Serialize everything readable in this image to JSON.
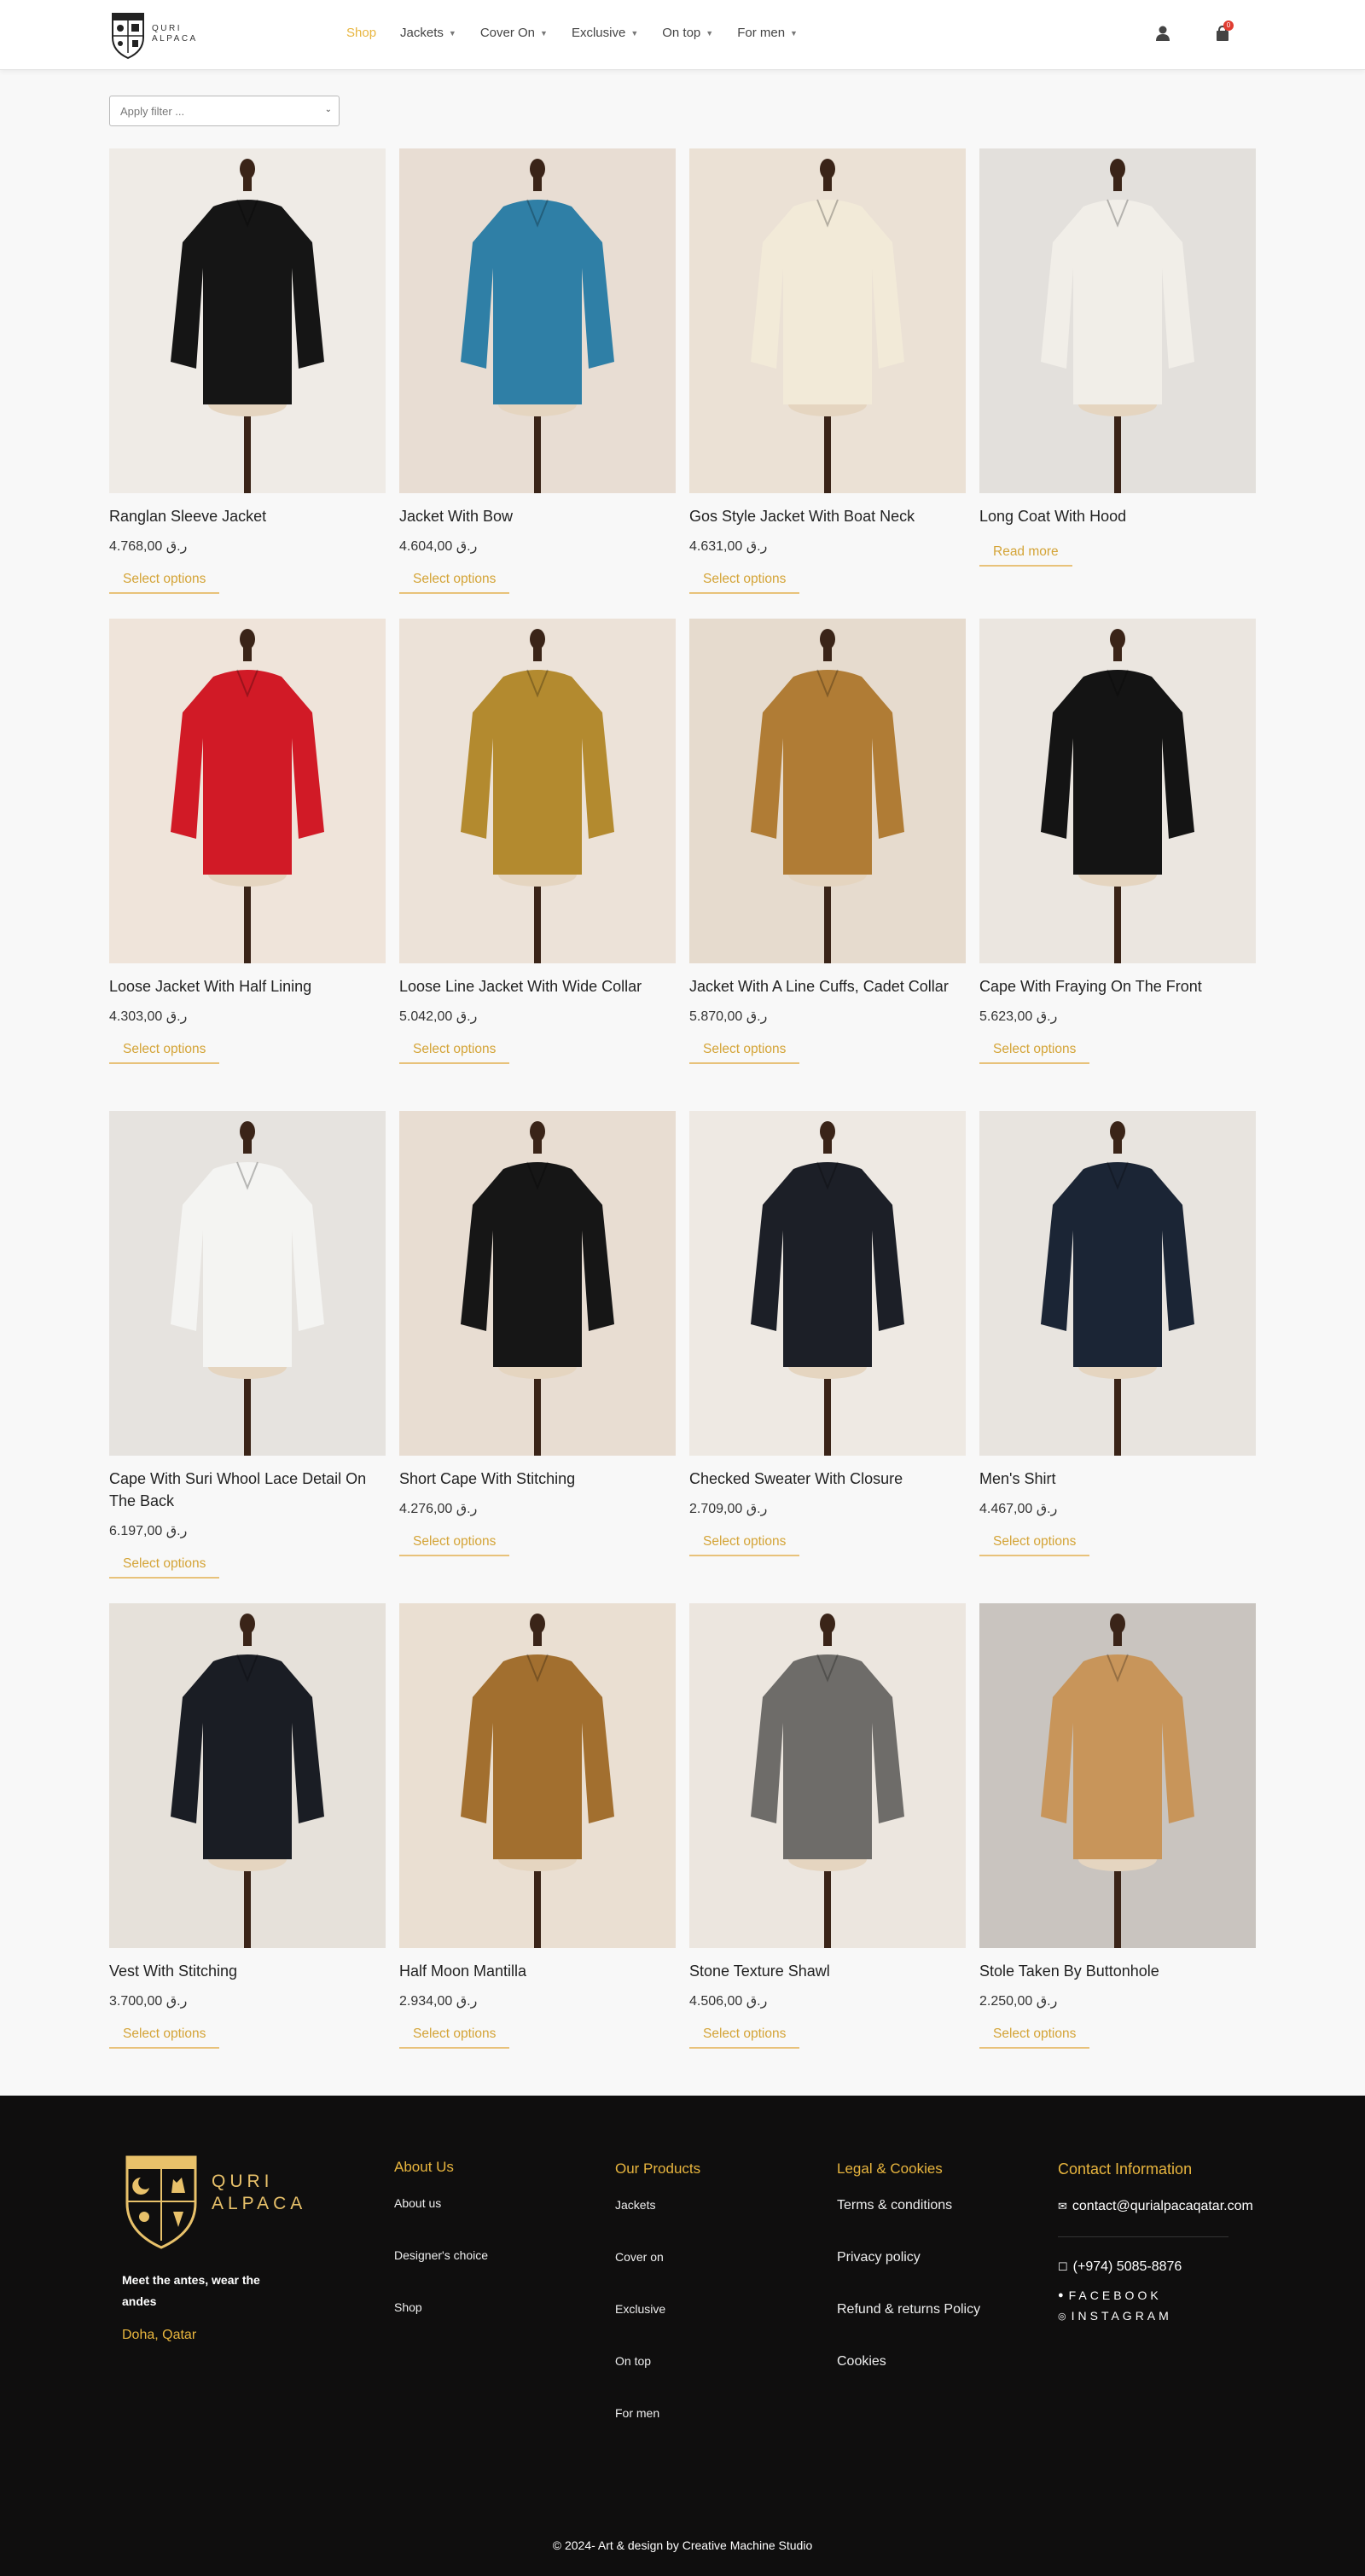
{
  "header": {
    "logo_text_line1": "QURI",
    "logo_text_line2": "ALPACA",
    "nav": [
      {
        "label": "Shop",
        "active": true,
        "has_dropdown": false
      },
      {
        "label": "Jackets",
        "active": false,
        "has_dropdown": true
      },
      {
        "label": "Cover On",
        "active": false,
        "has_dropdown": true
      },
      {
        "label": "Exclusive",
        "active": false,
        "has_dropdown": true
      },
      {
        "label": "On top",
        "active": false,
        "has_dropdown": true
      },
      {
        "label": "For men",
        "active": false,
        "has_dropdown": true
      }
    ],
    "account_icon": "user-icon",
    "cart_icon": "shopping-bag-icon",
    "cart_count": "0"
  },
  "filter": {
    "placeholder": "Apply filter ..."
  },
  "colors": {
    "accent": "#e8b53e",
    "footer_bg": "#0f0e0e"
  },
  "products": [
    {
      "title": "Ranglan Sleeve Jacket",
      "price": "ر.ق 4.768,00",
      "button": "Select options",
      "bg": "#efebe6",
      "garment": "#151515"
    },
    {
      "title": "Jacket With Bow",
      "price": "ر.ق 4.604,00",
      "button": "Select options",
      "bg": "#e8ddd3",
      "garment": "#2f7fa6"
    },
    {
      "title": "Gos Style Jacket With Boat Neck",
      "price": "ر.ق 4.631,00",
      "button": "Select options",
      "bg": "#ebe1d5",
      "garment": "#f2ead8"
    },
    {
      "title": "Long Coat With Hood",
      "price": "",
      "button": "Read more",
      "bg": "#e3e0dc",
      "garment": "#f1eee8"
    },
    {
      "title": "Loose Jacket With Half Lining",
      "price": "ر.ق 4.303,00",
      "button": "Select options",
      "bg": "#efe4da",
      "garment": "#d11a26"
    },
    {
      "title": "Loose Line Jacket With Wide Collar",
      "price": "ر.ق 5.042,00",
      "button": "Select options",
      "bg": "#ece2d8",
      "garment": "#b38a2f"
    },
    {
      "title": "Jacket With A Line Cuffs, Cadet Collar",
      "price": "ر.ق 5.870,00",
      "button": "Select options",
      "bg": "#e6dbce",
      "garment": "#b07c35"
    },
    {
      "title": "Cape With Fraying On The Front",
      "price": "ر.ق 5.623,00",
      "button": "Select options",
      "bg": "#ebe6e0",
      "garment": "#141414"
    },
    {
      "title": "Cape With Suri Whool Lace Detail On The Back",
      "price": "ر.ق 6.197,00",
      "button": "Select options",
      "bg": "#e6e3df",
      "garment": "#f4f4f2"
    },
    {
      "title": "Short Cape With Stitching",
      "price": "ر.ق 4.276,00",
      "button": "Select options",
      "bg": "#e8ddd2",
      "garment": "#161616"
    },
    {
      "title": "Checked Sweater With Closure",
      "price": "ر.ق 2.709,00",
      "button": "Select options",
      "bg": "#eee9e3",
      "garment": "#1c1f27"
    },
    {
      "title": "Men's Shirt",
      "price": "ر.ق 4.467,00",
      "button": "Select options",
      "bg": "#e8e4df",
      "garment": "#1b2535"
    },
    {
      "title": "Vest With Stitching",
      "price": "ر.ق 3.700,00",
      "button": "Select options",
      "bg": "#e6e1da",
      "garment": "#1a1d24"
    },
    {
      "title": "Half Moon Mantilla",
      "price": "ر.ق 2.934,00",
      "button": "Select options",
      "bg": "#eadfd2",
      "garment": "#a26f2f"
    },
    {
      "title": "Stone Texture Shawl",
      "price": "ر.ق 4.506,00",
      "button": "Select options",
      "bg": "#ece6df",
      "garment": "#6e6c69"
    },
    {
      "title": "Stole Taken By Buttonhole",
      "price": "ر.ق 2.250,00",
      "button": "Select options",
      "bg": "#c9c4bf",
      "garment": "#c8955a"
    }
  ],
  "footer": {
    "brand_line1": "QURI",
    "brand_line2": "ALPACA",
    "tagline": "Meet the antes, wear the andes",
    "city": "Doha, Qatar",
    "about": {
      "heading": "About Us",
      "links": [
        "About us",
        "Designer's choice",
        "Shop"
      ]
    },
    "products": {
      "heading": "Our Products",
      "links": [
        "Jackets",
        "Cover on",
        "Exclusive",
        "On top",
        "For men"
      ]
    },
    "legal": {
      "heading": "Legal & Cookies",
      "links": [
        "Terms & conditions",
        "Privacy policy",
        "Refund & returns Policy",
        "Cookies"
      ]
    },
    "contact": {
      "heading": "Contact Information",
      "email": "contact@qurialpacaqatar.com",
      "phone": "(+974) 5085-8876",
      "facebook": "FACEBOOK",
      "instagram": "INSTAGRAM"
    },
    "copyright": "© 2024- Art & design by Creative Machine Studio"
  }
}
